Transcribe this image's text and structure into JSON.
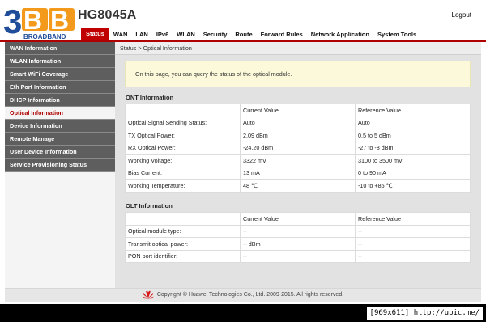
{
  "header": {
    "model": "HG8045A",
    "logout": "Logout",
    "logo_text": "3BB",
    "logo_sub": "BROADBAND"
  },
  "topnav": [
    {
      "label": "Status",
      "active": true
    },
    {
      "label": "WAN"
    },
    {
      "label": "LAN"
    },
    {
      "label": "IPv6"
    },
    {
      "label": "WLAN"
    },
    {
      "label": "Security"
    },
    {
      "label": "Route"
    },
    {
      "label": "Forward Rules"
    },
    {
      "label": "Network Application"
    },
    {
      "label": "System Tools"
    }
  ],
  "sidebar": [
    {
      "label": "WAN Information"
    },
    {
      "label": "WLAN Information"
    },
    {
      "label": "Smart WiFi Coverage"
    },
    {
      "label": "Eth Port Information"
    },
    {
      "label": "DHCP Information"
    },
    {
      "label": "Optical Information",
      "active": true
    },
    {
      "label": "Device Information"
    },
    {
      "label": "Remote Manage"
    },
    {
      "label": "User Device Information"
    },
    {
      "label": "Service Provisioning Status"
    }
  ],
  "breadcrumb": "Status > Optical Information",
  "notice": "On this page, you can query the status of the optical module.",
  "ont": {
    "title": "ONT Information",
    "headers": [
      "",
      "Current Value",
      "Reference Value"
    ],
    "rows": [
      [
        "Optical Signal Sending Status:",
        "Auto",
        "Auto"
      ],
      [
        "TX Optical Power:",
        "2.09 dBm",
        "0.5 to 5 dBm"
      ],
      [
        "RX Optical Power:",
        "-24.20 dBm",
        "-27 to -8 dBm"
      ],
      [
        "Working Voltage:",
        "3322 mV",
        "3100 to 3500 mV"
      ],
      [
        "Bias Current:",
        "13 mA",
        "0 to 90 mA"
      ],
      [
        "Working Temperature:",
        "48 ℃",
        "-10 to +85 ℃"
      ]
    ]
  },
  "olt": {
    "title": "OLT Information",
    "headers": [
      "",
      "Current Value",
      "Reference Value"
    ],
    "rows": [
      [
        "Optical module type:",
        "--",
        "--"
      ],
      [
        "Transmit optical power:",
        "-- dBm",
        "--"
      ],
      [
        "PON port identifier:",
        "--",
        "--"
      ]
    ]
  },
  "footer": "Copyright © Huawei Technologies Co., Ltd. 2009-2015. All rights reserved.",
  "watermark": "[969x611] http://upic.me/",
  "colors": {
    "accent": "#c00000",
    "logo_blue": "#1f4d9a",
    "logo_orange": "#f39a1c",
    "sidebar": "#5e5e5e"
  },
  "icons": {
    "logo": "3bb-logo",
    "footer": "huawei-logo"
  }
}
